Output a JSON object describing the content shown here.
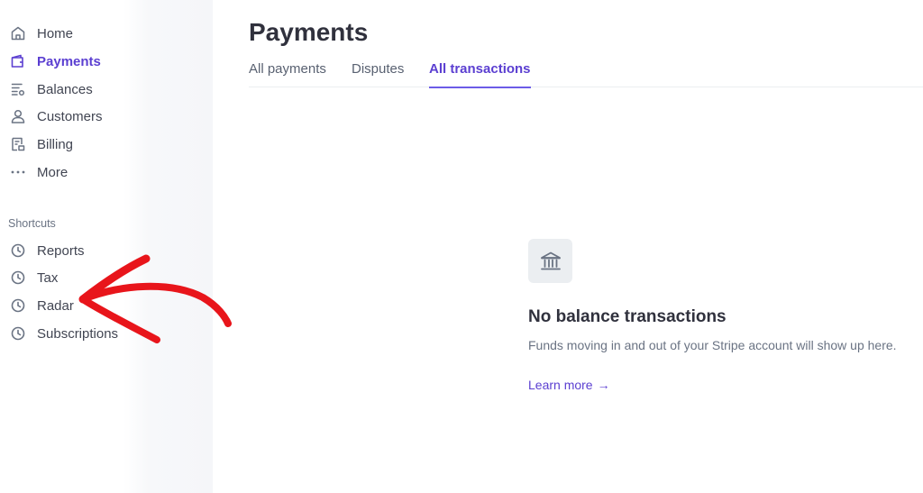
{
  "sidebar": {
    "items": [
      {
        "label": "Home",
        "icon": "home-icon",
        "active": false
      },
      {
        "label": "Payments",
        "icon": "wallet-icon",
        "active": true
      },
      {
        "label": "Balances",
        "icon": "balances-icon",
        "active": false
      },
      {
        "label": "Customers",
        "icon": "person-icon",
        "active": false
      },
      {
        "label": "Billing",
        "icon": "receipt-icon",
        "active": false
      },
      {
        "label": "More",
        "icon": "more-dots-icon",
        "active": false
      }
    ],
    "shortcuts_title": "Shortcuts",
    "shortcuts": [
      {
        "label": "Reports",
        "icon": "clock-icon"
      },
      {
        "label": "Tax",
        "icon": "clock-icon"
      },
      {
        "label": "Radar",
        "icon": "clock-icon"
      },
      {
        "label": "Subscriptions",
        "icon": "clock-icon"
      }
    ]
  },
  "main": {
    "title": "Payments",
    "tabs": [
      {
        "label": "All payments",
        "active": false
      },
      {
        "label": "Disputes",
        "active": false
      },
      {
        "label": "All transactions",
        "active": true
      }
    ],
    "empty_state": {
      "icon": "bank-icon",
      "title": "No balance transactions",
      "description": "Funds moving in and out of your Stripe account will show up here.",
      "link_label": "Learn more",
      "link_arrow": "→"
    }
  },
  "annotation": {
    "type": "red-arrow",
    "color": "#e8151b",
    "points_to": "Radar"
  },
  "colors": {
    "accent": "#5b3fd1",
    "text": "#30313d",
    "muted": "#6a7383"
  }
}
